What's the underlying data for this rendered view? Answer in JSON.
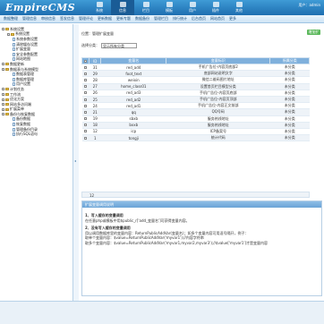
{
  "header": {
    "logo": "EmpireCMS",
    "user_label": "用户：admin",
    "nav": [
      {
        "label": "系统"
      },
      {
        "label": "信息"
      },
      {
        "label": "栏目"
      },
      {
        "label": "模板"
      },
      {
        "label": "用户"
      },
      {
        "label": "插件"
      },
      {
        "label": "其他"
      }
    ]
  },
  "subnav": [
    "数据整理",
    "管理信息",
    "审核信息",
    "签发信息",
    "管理评论",
    "更新数据",
    "更新专题",
    "数据备份",
    "管理栏目",
    "排行统计",
    "后台首页",
    "网站首页",
    "更多"
  ],
  "tree": [
    {
      "label": "系统设置",
      "level": 0,
      "kind": "folder"
    },
    {
      "label": "系统设置",
      "level": 1,
      "kind": "folder"
    },
    {
      "label": "系统参数设置",
      "level": 2,
      "kind": "doc"
    },
    {
      "label": "清除缓存设置",
      "level": 2,
      "kind": "doc"
    },
    {
      "label": "扩展变量",
      "level": 2,
      "kind": "doc"
    },
    {
      "label": "安全参数配置",
      "level": 2,
      "kind": "doc"
    },
    {
      "label": "网站地图",
      "level": 2,
      "kind": "doc"
    },
    {
      "label": "数据更新",
      "level": 0,
      "kind": "folder"
    },
    {
      "label": "数据表与系统模型",
      "level": 0,
      "kind": "folder"
    },
    {
      "label": "数据表管理",
      "level": 2,
      "kind": "doc"
    },
    {
      "label": "数据库管理",
      "level": 2,
      "kind": "doc"
    },
    {
      "label": "用户设置",
      "level": 2,
      "kind": "doc"
    },
    {
      "label": "计划任务",
      "level": 0,
      "kind": "folder"
    },
    {
      "label": "工作流",
      "level": 0,
      "kind": "folder"
    },
    {
      "label": "优化方案",
      "level": 0,
      "kind": "folder"
    },
    {
      "label": "网站多访问端",
      "level": 0,
      "kind": "folder"
    },
    {
      "label": "扩展菜单",
      "level": 0,
      "kind": "folder"
    },
    {
      "label": "备份与恢复数据",
      "level": 0,
      "kind": "folder"
    },
    {
      "label": "备份数据",
      "level": 2,
      "kind": "doc"
    },
    {
      "label": "恢复数据",
      "level": 2,
      "kind": "doc"
    },
    {
      "label": "管理备份目录",
      "level": 2,
      "kind": "doc"
    },
    {
      "label": "执行SQL语句",
      "level": 2,
      "kind": "doc"
    }
  ],
  "main": {
    "breadcrumb": "位置：管理扩展变量",
    "add_button": "增加扩展变量",
    "filter_label": "选择分类：",
    "filter_value": "显示所有分类",
    "columns": [
      "ID",
      "变量名",
      "变量标识",
      "所属分类"
    ],
    "rows": [
      {
        "id": "31",
        "name": "red_ad4",
        "label": "手机广告位-内容页底部2",
        "category": "未分类"
      },
      {
        "id": "29",
        "name": "foot_text",
        "label": "底部网站说明文字",
        "category": "未分类"
      },
      {
        "id": "28",
        "name": "weixin",
        "label": "微信二维码图片地址",
        "category": "未分类"
      },
      {
        "id": "27",
        "name": "home_class01",
        "label": "设置首页栏目模型分类",
        "category": "未分类"
      },
      {
        "id": "26",
        "name": "red_ad3",
        "label": "手机广告位-内容页底部",
        "category": "未分类"
      },
      {
        "id": "25",
        "name": "red_ad2",
        "label": "手机广告位-内容页顶部",
        "category": "未分类"
      },
      {
        "id": "24",
        "name": "red_ad1",
        "label": "手机广告位-内容正文前部",
        "category": "未分类"
      },
      {
        "id": "21",
        "name": "qq",
        "label": "QQ号码",
        "category": "未分类"
      },
      {
        "id": "19",
        "name": "sbxb",
        "label": "服务热线地址",
        "category": "未分类"
      },
      {
        "id": "18",
        "name": "bxxb",
        "label": "服务热线地址",
        "category": "未分类"
      },
      {
        "id": "12",
        "name": "icp",
        "label": "ICP备案号",
        "category": "未分类"
      },
      {
        "id": "1",
        "name": "tongji",
        "label": "统计代码",
        "category": "未分类"
      }
    ],
    "page": "12",
    "side_tags": [
      "",
      ""
    ]
  },
  "tips": {
    "title": "扩展变量调用说明",
    "h1": "1、写入缓存的变量调用",
    "p1": "在任意php或模板中用$public_r['add_变量名']可获得变量内容。",
    "h2": "2、没有写入缓存的变量调用",
    "p2": "用以调用数据库里的变量内容：ReturnPublicAddVar(变量名)；如多个变量内容可用逗号隔开，例子：",
    "p3": "取单个变量内容：$value=ReturnPublicAddVar('myvar1');//内容字符串",
    "p4": "取多个变量内容：$value=ReturnPublicAddVar('myvar1,myvar2,myvar3');//$value['myvar1']才是变量内容"
  }
}
